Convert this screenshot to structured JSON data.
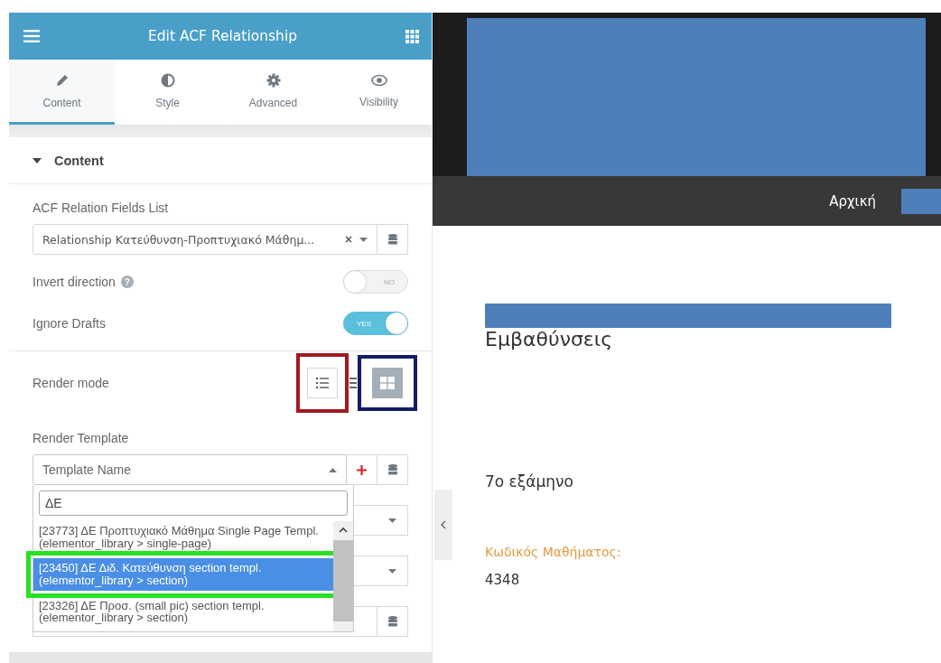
{
  "panel": {
    "title": "Edit ACF Relationship",
    "tabs": [
      {
        "label": "Content",
        "kind": "pencil",
        "selected": true
      },
      {
        "label": "Style",
        "kind": "contrast",
        "selected": false
      },
      {
        "label": "Advanced",
        "kind": "gear",
        "selected": false
      },
      {
        "label": "Visibility",
        "kind": "eye",
        "selected": false
      }
    ],
    "section": {
      "title": "Content",
      "expanded": true
    },
    "fields_list": {
      "label": "ACF Relation Fields List",
      "value": "Relationship Κατεύθυνση-Προπτυχιακό Μάθημ..."
    },
    "toggles": [
      {
        "label": "Invert direction",
        "help": "?",
        "on": false,
        "text": "NO"
      },
      {
        "label": "Ignore Drafts",
        "on": true,
        "text": "YES"
      }
    ],
    "render_mode": {
      "label": "Render mode",
      "modes": [
        {
          "kind": "list",
          "selected": false
        },
        {
          "kind": "rows",
          "selected": false
        },
        {
          "kind": "grid",
          "selected": true
        }
      ]
    },
    "render_template": {
      "label": "Render Template",
      "placeholder": "Template Name",
      "open": true,
      "search": "ΔΕ",
      "options": [
        {
          "text": "[23773] ΔΕ Προπτυχιακό Μάθημα Single Page Templ. (elementor_library > single-page)",
          "selected": false
        },
        {
          "text": "[23450] ΔΕ Διδ. Κατεύθυνση section templ. (elementor_library > section)",
          "selected": true
        },
        {
          "text": "[23326] ΔΕ Προσ. (small pic) section templ. (elementor_library > section)",
          "selected": false
        }
      ]
    }
  },
  "site": {
    "nav": [
      {
        "label": "Αρχική"
      }
    ],
    "heading": "Εμβαθύνσεις",
    "semester": "7ο εξάμηνο",
    "code_label": "Κωδικός Μαθήματος:",
    "code": "4348"
  }
}
